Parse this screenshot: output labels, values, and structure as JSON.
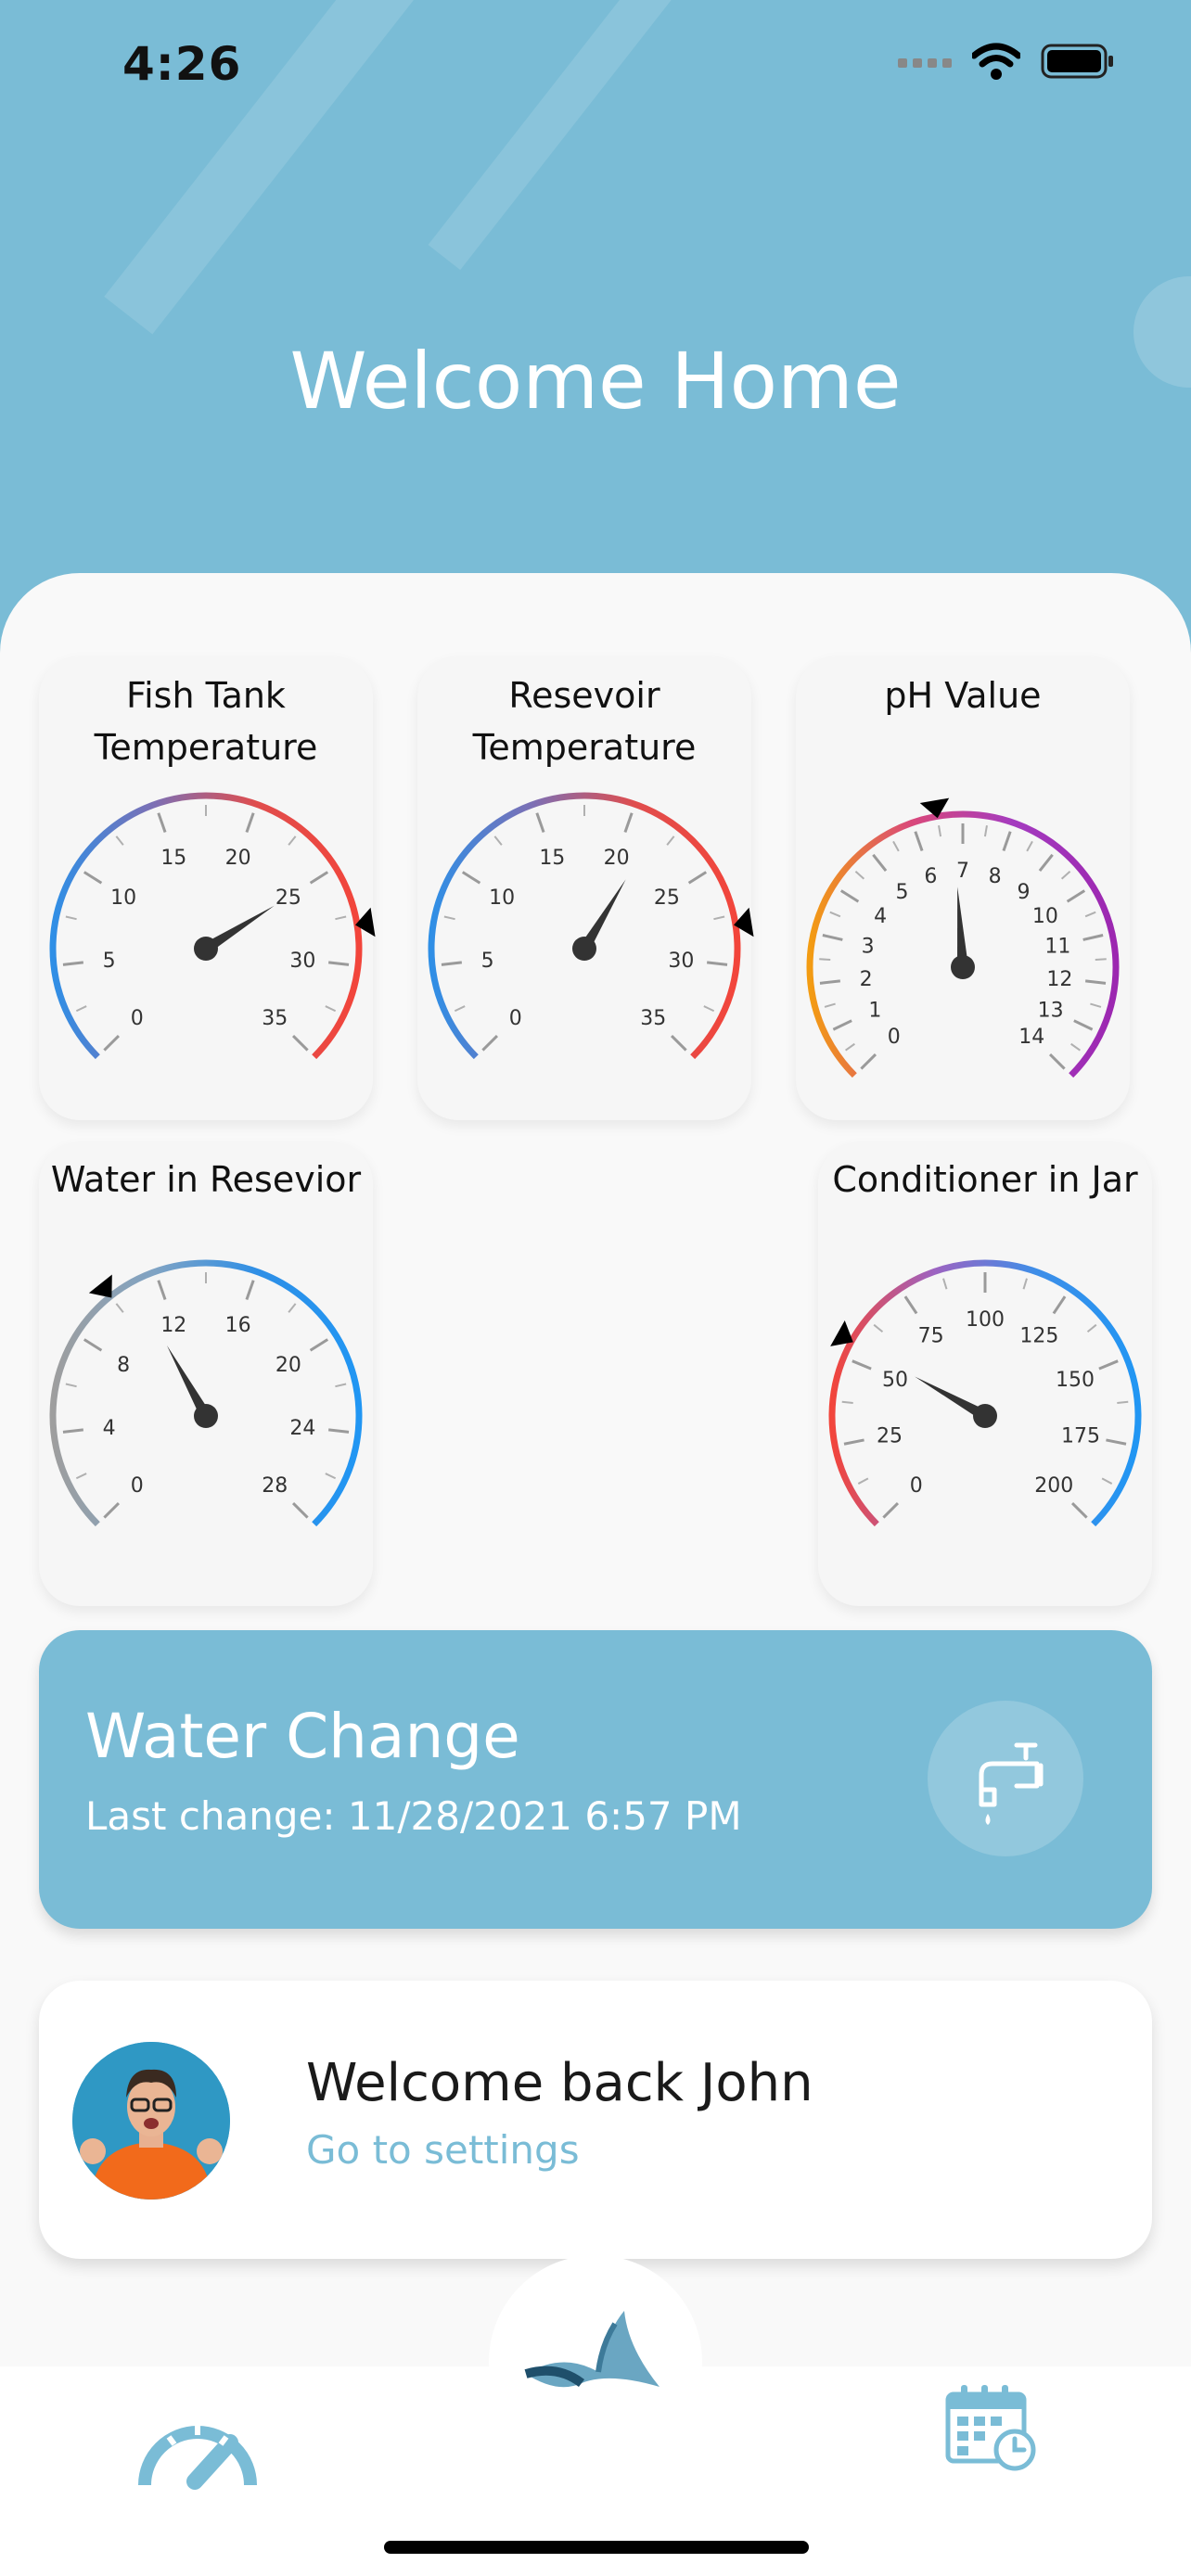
{
  "status_bar": {
    "time": "4:26"
  },
  "header": {
    "title": "Welcome Home"
  },
  "gauges": [
    {
      "title_line1": "Fish Tank",
      "title_line2": "Temperature",
      "min": 0,
      "max": 35,
      "step": 5,
      "value": 25,
      "pointer_value": 28,
      "colors": [
        "#2f8fe6",
        "#7d6fb4",
        "#e04d4d",
        "#f2453b"
      ]
    },
    {
      "title_line1": "Resevoir",
      "title_line2": "Temperature",
      "min": 0,
      "max": 35,
      "step": 5,
      "value": 21.5,
      "pointer_value": 28,
      "colors": [
        "#2f8fe6",
        "#7d6fb4",
        "#e04d4d",
        "#f2453b"
      ]
    },
    {
      "title_line1": "pH Value",
      "title_line2": "",
      "min": 0,
      "max": 14,
      "step": 1,
      "value": 6.8,
      "pointer_value": 6.5,
      "colors": [
        "#f39c12",
        "#d9487b",
        "#a43bbf",
        "#9c27b0"
      ]
    },
    {
      "title_line1": "Water in Resevior",
      "title_line2": "",
      "min": 0,
      "max": 28,
      "step": 4,
      "value": 11,
      "pointer_value": 10,
      "colors": [
        "#9e9e9e",
        "#7fa3c4",
        "#2f8fe6",
        "#2196f3"
      ]
    },
    {
      "title_line1": "Conditioner in Jar",
      "title_line2": "",
      "min": 0,
      "max": 200,
      "step": 25,
      "value": 55,
      "pointer_value": 55,
      "colors": [
        "#f2453b",
        "#9d63c1",
        "#3e8ee8",
        "#2196f3"
      ]
    }
  ],
  "water_change": {
    "title": "Water Change",
    "last_change": "Last change: 11/28/2021 6:57 PM",
    "icon": "faucet-icon"
  },
  "user_card": {
    "welcome": "Welcome back John",
    "settings_link": "Go to settings"
  },
  "nav": {
    "left_icon": "speedometer-icon",
    "center_icon": "fish-fin-icon",
    "right_icon": "calendar-clock-icon",
    "accent": "#7abcd6"
  }
}
